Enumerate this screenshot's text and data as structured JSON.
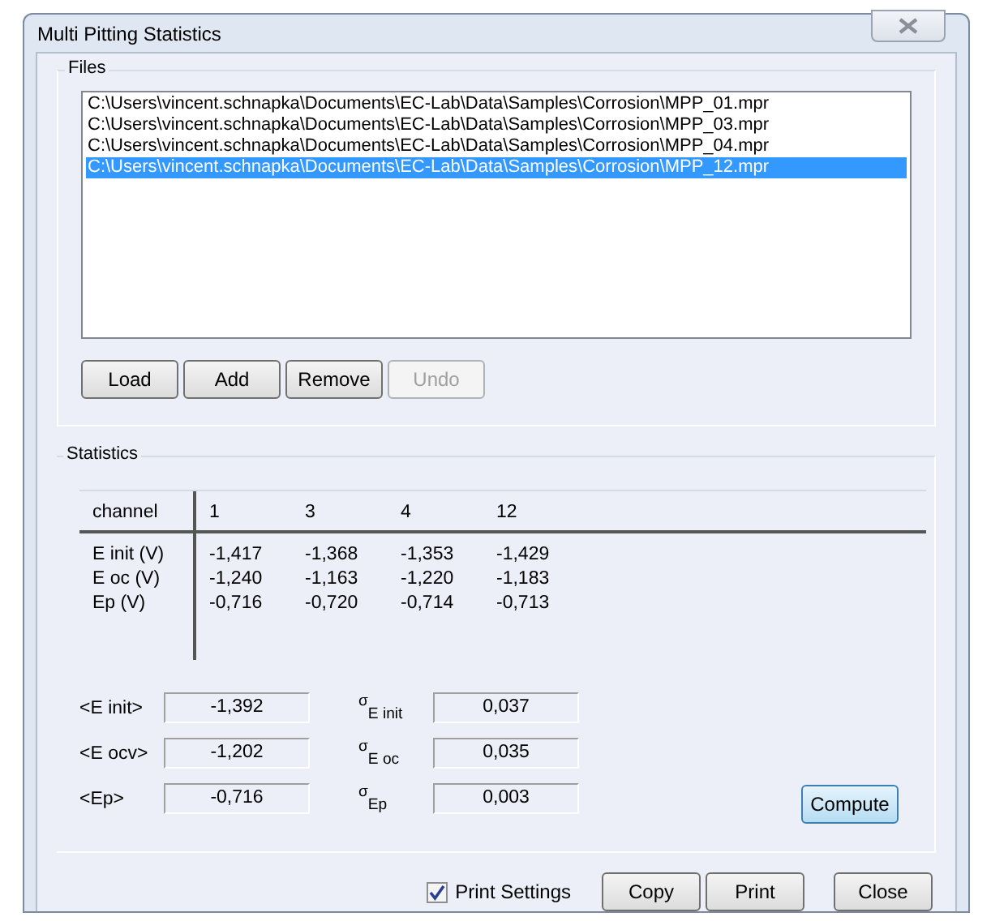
{
  "window": {
    "title": "Multi Pitting Statistics"
  },
  "files": {
    "title": "Files",
    "items": [
      {
        "path": "C:\\Users\\vincent.schnapka\\Documents\\EC-Lab\\Data\\Samples\\Corrosion\\MPP_01.mpr",
        "selected": false
      },
      {
        "path": "C:\\Users\\vincent.schnapka\\Documents\\EC-Lab\\Data\\Samples\\Corrosion\\MPP_03.mpr",
        "selected": false
      },
      {
        "path": "C:\\Users\\vincent.schnapka\\Documents\\EC-Lab\\Data\\Samples\\Corrosion\\MPP_04.mpr",
        "selected": false
      },
      {
        "path": "C:\\Users\\vincent.schnapka\\Documents\\EC-Lab\\Data\\Samples\\Corrosion\\MPP_12.mpr",
        "selected": true
      }
    ],
    "buttons": [
      {
        "label": "Load",
        "disabled": false
      },
      {
        "label": "Add",
        "disabled": false
      },
      {
        "label": "Remove",
        "disabled": false
      },
      {
        "label": "Undo",
        "disabled": true
      }
    ]
  },
  "statistics": {
    "title": "Statistics",
    "table": {
      "columns": [
        "channel",
        "1",
        "3",
        "4",
        "12"
      ],
      "rows": [
        [
          "E init (V)",
          "-1,417",
          "-1,368",
          "-1,353",
          "-1,429"
        ],
        [
          "E oc (V)",
          "-1,240",
          "-1,163",
          "-1,220",
          "-1,183"
        ],
        [
          "Ep (V)",
          "-0,716",
          "-0,720",
          "-0,714",
          "-0,713"
        ]
      ]
    },
    "means": [
      {
        "label": "<E init>",
        "value": "-1,392"
      },
      {
        "label": "<E ocv>",
        "value": "-1,202"
      },
      {
        "label": "<Ep>",
        "value": "-0,716"
      }
    ],
    "deviations": [
      {
        "label": "$^{σ}$$_{E init}$",
        "value": "0,037"
      },
      {
        "label": "$^{σ}$$_{E oc}$",
        "value": "0,035"
      },
      {
        "label": "$^{σ}$$_{Ep}$",
        "value": "0,003"
      }
    ],
    "compute_button": "Compute"
  },
  "print_settings": {
    "label": "Print Settings",
    "checked": true
  },
  "buttons": [
    "Copy",
    "Print",
    "Close"
  ]
}
